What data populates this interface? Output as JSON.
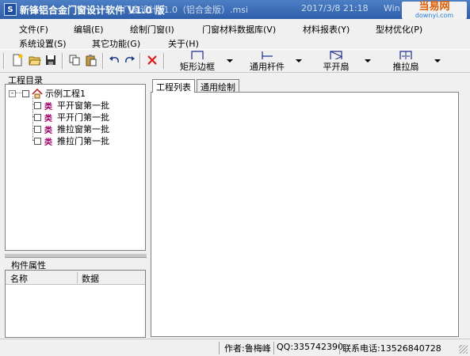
{
  "window": {
    "title": "新锋铝合金门窗设计软件 V1.0 版",
    "background_title": "门窗设计V1.0（铝合金版）.msi",
    "background_date": "2017/3/8 21:18",
    "background_win": "Win"
  },
  "watermark": {
    "main": "当易网",
    "sub": "downyi.com"
  },
  "menu": [
    {
      "label": "文件(F)"
    },
    {
      "label": "编辑(E)"
    },
    {
      "label": "绘制门窗(I)"
    },
    {
      "label": "门窗材料数据库(V)"
    },
    {
      "label": "材料报表(Y)"
    },
    {
      "label": "型材优化(P)"
    },
    {
      "label": "系统设置(S)"
    },
    {
      "label": "其它功能(G)"
    },
    {
      "label": "关于(H)"
    }
  ],
  "toolbar": {
    "big_buttons": [
      {
        "label": "矩形边框"
      },
      {
        "label": "通用杆件"
      },
      {
        "label": "平开扇"
      },
      {
        "label": "推拉扇"
      }
    ]
  },
  "project_tree": {
    "title": "工程目录",
    "root": "示例工程1",
    "type_marker": "类",
    "items": [
      "平开窗第一批",
      "平开门第一批",
      "推拉窗第一批",
      "推拉门第一批"
    ]
  },
  "properties": {
    "title": "构件属性",
    "columns": [
      "名称",
      "数据"
    ]
  },
  "tabs": [
    {
      "label": "工程列表"
    },
    {
      "label": "通用绘制"
    }
  ],
  "status": {
    "author": "作者:鲁梅峰",
    "qq": "QQ:335742390",
    "phone": "联系电话:13526840728"
  }
}
